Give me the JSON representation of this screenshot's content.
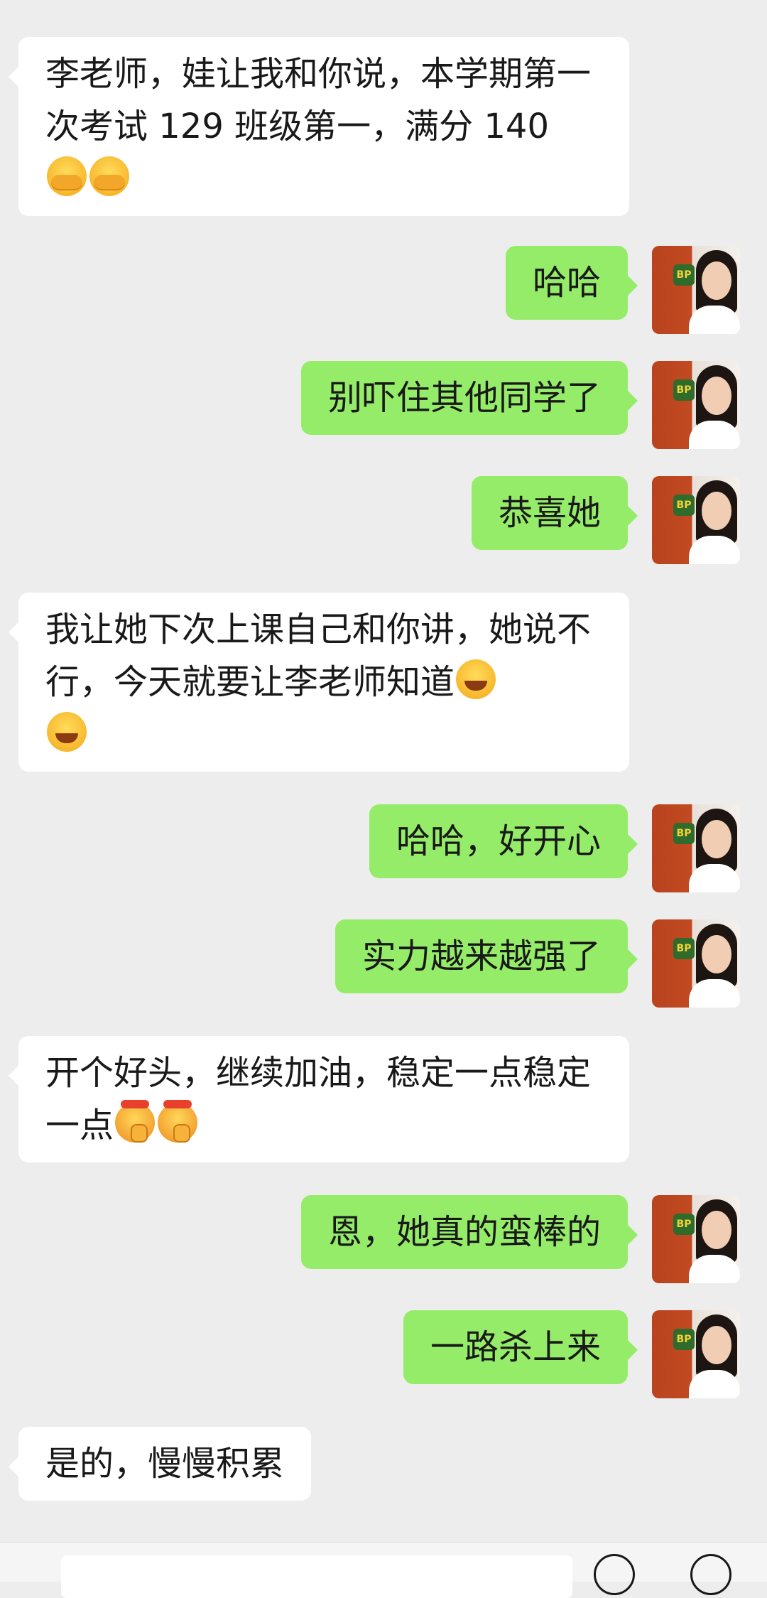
{
  "messages": [
    {
      "side": "left",
      "text": "李老师，娃让我和你说，本学期第一次考试 129 班级第一，满分 140",
      "emojis": [
        "cover-face",
        "cover-face"
      ]
    },
    {
      "side": "right",
      "text": "哈哈",
      "emojis": []
    },
    {
      "side": "right",
      "text": "别吓住其他同学了",
      "emojis": []
    },
    {
      "side": "right",
      "text": "恭喜她",
      "emojis": []
    },
    {
      "side": "left",
      "text": "我让她下次上课自己和你讲，她说不行，今天就要让李老师知道",
      "emojis": [
        "tears-of-joy",
        "tears-of-joy"
      ]
    },
    {
      "side": "right",
      "text": "哈哈，好开心",
      "emojis": []
    },
    {
      "side": "right",
      "text": "实力越来越强了",
      "emojis": []
    },
    {
      "side": "left",
      "text": "开个好头，继续加油，稳定一点稳定一点",
      "emojis": [
        "determined-face",
        "determined-face"
      ]
    },
    {
      "side": "right",
      "text": "恩，她真的蛮棒的",
      "emojis": []
    },
    {
      "side": "right",
      "text": "一路杀上来",
      "emojis": []
    },
    {
      "side": "left",
      "text": "是的，慢慢积累",
      "emojis": []
    }
  ],
  "colors": {
    "background": "#ededed",
    "sent_bubble": "#95ec69",
    "received_bubble": "#ffffff"
  }
}
